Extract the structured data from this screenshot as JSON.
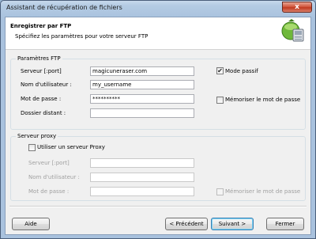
{
  "window": {
    "title": "Assistant de récupération de fichiers",
    "close_label": "x"
  },
  "header": {
    "title": "Enregistrer par FTP",
    "subtitle": "Spécifiez les paramètres pour votre serveur FTP"
  },
  "ftp": {
    "legend": "Paramètres FTP",
    "server_label": "Serveur [:port]",
    "server_value": "magicuneraser.com",
    "user_label": "Nom d'utilisateur :",
    "user_value": "my_username",
    "password_label": "Mot de passe :",
    "password_value": "**********",
    "folder_label": "Dossier distant :",
    "folder_value": "",
    "passive_mode_label": "Mode passif",
    "passive_mode_checked": true,
    "remember_password_label": "Mémoriser le mot de passe",
    "remember_password_checked": false
  },
  "proxy": {
    "legend": "Serveur proxy",
    "use_proxy_label": "Utiliser un serveur Proxy",
    "use_proxy_checked": false,
    "server_label": "Serveur [:port]",
    "server_value": "",
    "user_label": "Nom d'utilisateur :",
    "user_value": "",
    "password_label": "Mot de passe :",
    "password_value": "",
    "remember_password_label": "Mémoriser le mot de passe",
    "remember_password_checked": false
  },
  "footer": {
    "help_label": "Aide",
    "previous_label": "< Précédent",
    "next_label": "Suivant >",
    "close_label": "Fermer"
  },
  "check_glyph": "✔"
}
